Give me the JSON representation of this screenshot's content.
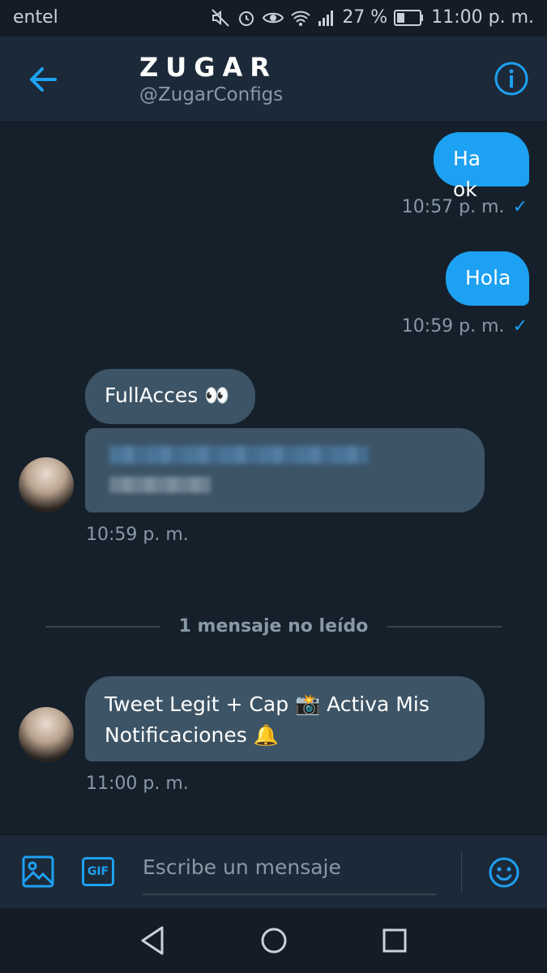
{
  "status": {
    "carrier": "entel",
    "battery": "27 %",
    "time": "11:00 p. m."
  },
  "header": {
    "name": "ZUGAR",
    "handle": "@ZugarConfigs"
  },
  "messages": [
    {
      "direction": "out",
      "text": "Ha ok",
      "time": "10:57 p. m."
    },
    {
      "direction": "out",
      "text": "Hola",
      "time": "10:59 p. m."
    },
    {
      "direction": "in",
      "text": "FullAcces 👀",
      "time": "10:59 p. m."
    },
    {
      "direction": "in",
      "text": "Tweet Legit + Cap 📸 Activa Mis Notificaciones 🔔",
      "time": "11:00 p. m."
    }
  ],
  "unread_divider": "1 mensaje no leído",
  "compose": {
    "placeholder": "Escribe un mensaje",
    "gif_label": "GIF"
  },
  "colors": {
    "accent": "#1da1f2",
    "background": "#15202b",
    "incoming_bubble": "#3d5466"
  }
}
